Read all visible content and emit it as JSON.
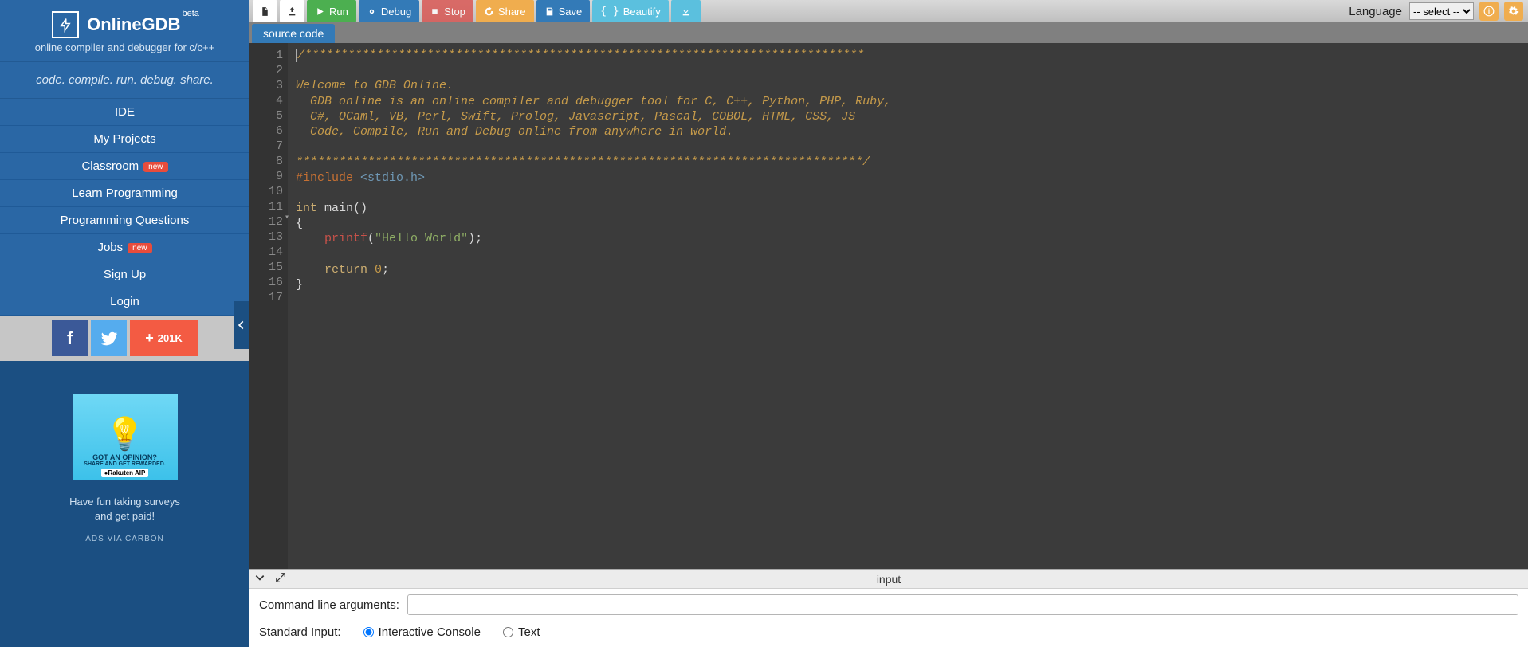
{
  "brand": {
    "name": "OnlineGDB",
    "beta": "beta",
    "subtitle": "online compiler and debugger for c/c++",
    "tagline": "code. compile. run. debug. share."
  },
  "nav": [
    {
      "label": "IDE",
      "badge": null
    },
    {
      "label": "My Projects",
      "badge": null
    },
    {
      "label": "Classroom",
      "badge": "new"
    },
    {
      "label": "Learn Programming",
      "badge": null
    },
    {
      "label": "Programming Questions",
      "badge": null
    },
    {
      "label": "Jobs",
      "badge": "new"
    },
    {
      "label": "Sign Up",
      "badge": null
    },
    {
      "label": "Login",
      "badge": null
    }
  ],
  "social": {
    "share_count": "201K"
  },
  "ad": {
    "headline": "GOT AN OPINION?",
    "sub": "SHARE AND GET REWARDED.",
    "brand": "●Rakuten AIP",
    "text1": "Have fun taking surveys",
    "text2": "and get paid!",
    "via": "ADS VIA CARBON"
  },
  "toolbar": {
    "run": "Run",
    "debug": "Debug",
    "stop": "Stop",
    "share": "Share",
    "save": "Save",
    "beautify": "Beautify",
    "language_label": "Language",
    "language_value": "-- select --"
  },
  "tab": {
    "name": "source code"
  },
  "code": {
    "lines": [
      "/******************************************************************************",
      "",
      "Welcome to GDB Online.",
      "  GDB online is an online compiler and debugger tool for C, C++, Python, PHP, Ruby, ",
      "  C#, OCaml, VB, Perl, Swift, Prolog, Javascript, Pascal, COBOL, HTML, CSS, JS",
      "  Code, Compile, Run and Debug online from anywhere in world.",
      "",
      "*******************************************************************************/",
      "#include <stdio.h>",
      "",
      "int main()",
      "{",
      "    printf(\"Hello World\");",
      "",
      "    return 0;",
      "}",
      ""
    ]
  },
  "io": {
    "title": "input",
    "cmd_label": "Command line arguments:",
    "cmd_value": "",
    "stdin_label": "Standard Input:",
    "opt_console": "Interactive Console",
    "opt_text": "Text"
  }
}
